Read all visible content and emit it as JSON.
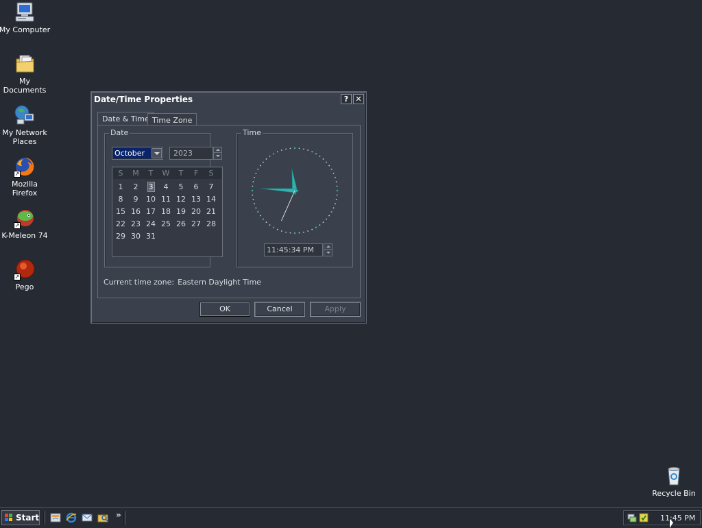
{
  "desktop": {
    "icons": [
      {
        "label": "My Computer",
        "icon": "my-computer-icon"
      },
      {
        "label": "My Documents",
        "icon": "my-documents-icon"
      },
      {
        "label": "My Network Places",
        "icon": "network-places-icon"
      },
      {
        "label": "Mozilla Firefox",
        "icon": "firefox-icon"
      },
      {
        "label": "K-Meleon 74",
        "icon": "k-meleon-icon"
      },
      {
        "label": "Pego",
        "icon": "pego-icon"
      },
      {
        "label": "Recycle Bin",
        "icon": "recycle-bin-icon"
      }
    ]
  },
  "dialog": {
    "title": "Date/Time Properties",
    "help_button": "?",
    "close_button": "✕",
    "tabs": [
      "Date & Time",
      "Time Zone"
    ],
    "date_group_label": "Date",
    "time_group_label": "Time",
    "month": "October",
    "year": "2023",
    "weekday_headers": [
      "S",
      "M",
      "T",
      "W",
      "T",
      "F",
      "S"
    ],
    "days": [
      "1",
      "2",
      "3",
      "4",
      "5",
      "6",
      "7",
      "8",
      "9",
      "10",
      "11",
      "12",
      "13",
      "14",
      "15",
      "16",
      "17",
      "18",
      "19",
      "20",
      "21",
      "22",
      "23",
      "24",
      "25",
      "26",
      "27",
      "28",
      "29",
      "30",
      "31"
    ],
    "selected_day": "3",
    "time_value": "11:45:34 PM",
    "timezone_label": "Current time zone:",
    "timezone_value": "Eastern Daylight Time",
    "buttons": {
      "ok": "OK",
      "cancel": "Cancel",
      "apply": "Apply"
    }
  },
  "taskbar": {
    "start_label": "Start",
    "quick_launch": [
      "show-desktop-icon",
      "internet-explorer-icon",
      "outlook-icon",
      "explorer-icon"
    ],
    "overflow": "»",
    "tray_icons": [
      "network-tray-icon",
      "security-tray-icon"
    ],
    "clock": "11:45 PM"
  },
  "colors": {
    "desktop_bg": "#252a33",
    "dialog_bg": "#3b414c",
    "clock_accent": "#2fb3b0",
    "selection": "#0a246a"
  }
}
